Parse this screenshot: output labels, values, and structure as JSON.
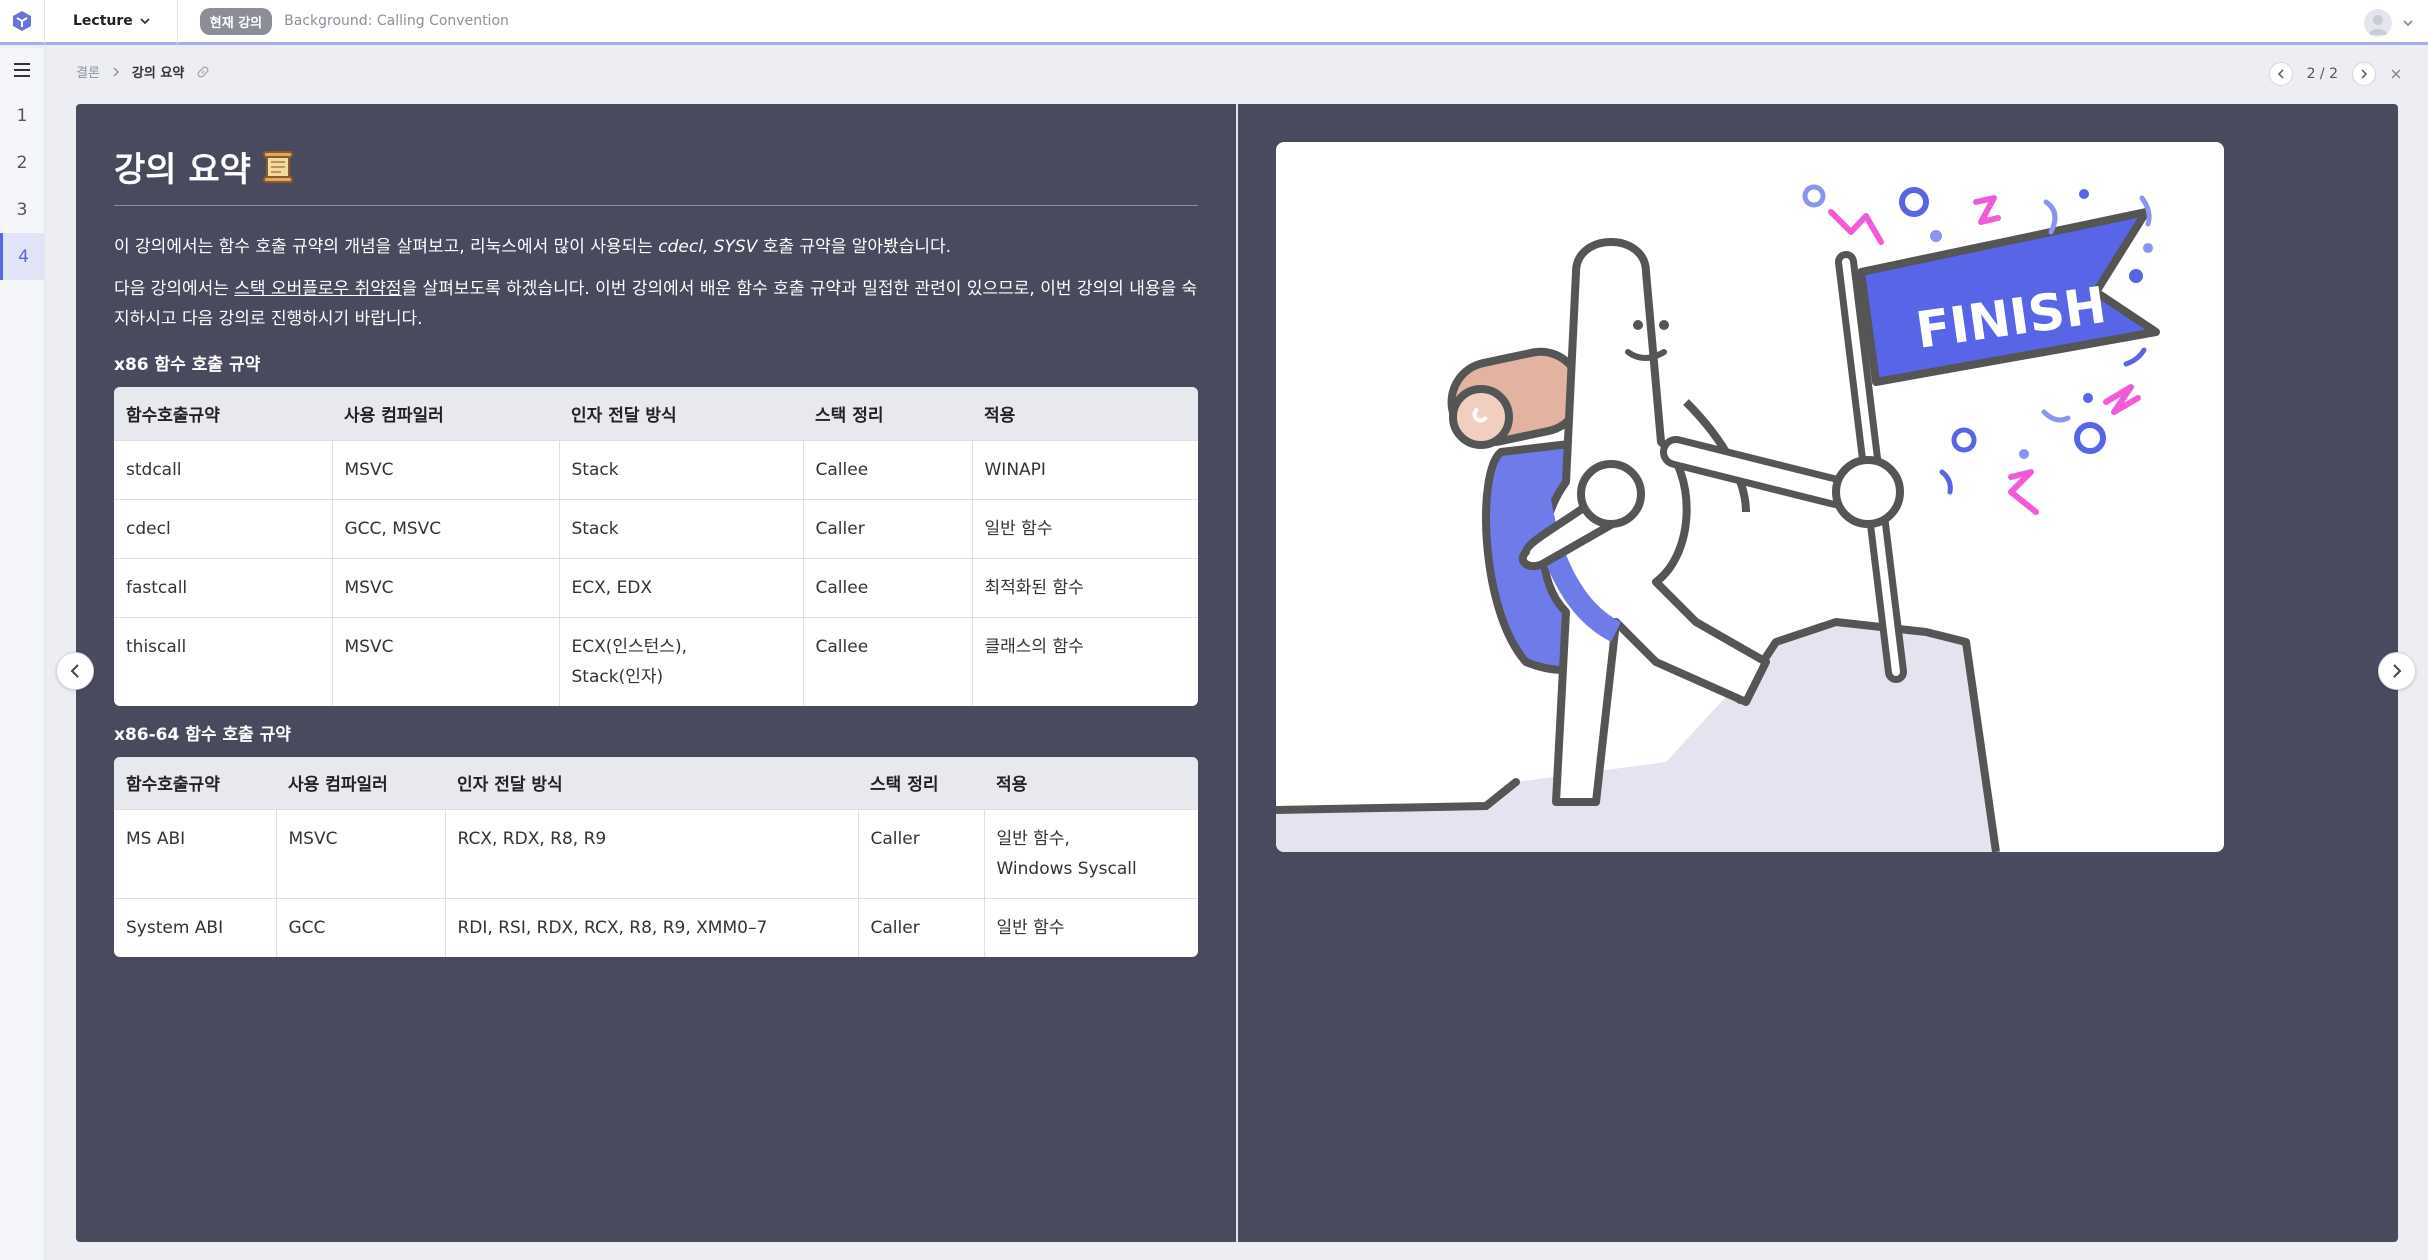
{
  "topbar": {
    "lecture_label": "Lecture",
    "current_badge": "현재 강의",
    "current_title": "Background: Calling Convention"
  },
  "rail": {
    "items": [
      {
        "label": "1"
      },
      {
        "label": "2"
      },
      {
        "label": "3"
      },
      {
        "label": "4",
        "active": true
      }
    ]
  },
  "breadcrumb": {
    "parent": "결론",
    "current": "강의 요약"
  },
  "pager": {
    "text": "2 / 2"
  },
  "slide": {
    "title": "강의 요약",
    "title_icon": "scroll-icon",
    "intro_prefix": "이 강의에서는 함수 호출 규약의 개념을 살펴보고, 리눅스에서 많이 사용되는 ",
    "intro_em": "cdecl, SYSV",
    "intro_suffix": " 호출 규약을 알아봤습니다.",
    "next_prefix": "다음 강의에서는 ",
    "next_link": "스택 오버플로우 취약점",
    "next_suffix": "을 살펴보도록 하겠습니다. 이번 강의에서 배운 함수 호출 규약과 밀접한 관련이 있으므로, 이번 강의의 내용을 숙지하시고 다음 강의로 진행하시기 바랍니다.",
    "x86_heading": "x86 함수 호출 규약",
    "x86_table": {
      "headers": [
        "함수호출규약",
        "사용 컴파일러",
        "인자 전달 방식",
        "스택 정리",
        "적용"
      ],
      "rows": [
        [
          "stdcall",
          "MSVC",
          "Stack",
          "Callee",
          "WINAPI"
        ],
        [
          "cdecl",
          "GCC, MSVC",
          "Stack",
          "Caller",
          "일반 함수"
        ],
        [
          "fastcall",
          "MSVC",
          "ECX, EDX",
          "Callee",
          "최적화된 함수"
        ],
        [
          "thiscall",
          "MSVC",
          "ECX(인스턴스),\nStack(인자)",
          "Callee",
          "클래스의 함수"
        ]
      ]
    },
    "x64_heading": "x86-64 함수 호출 규약",
    "x64_table": {
      "headers": [
        "함수호출규약",
        "사용 컴파일러",
        "인자 전달 방식",
        "스택 정리",
        "적용"
      ],
      "rows": [
        [
          "MS ABI",
          "MSVC",
          "RCX, RDX, R8, R9",
          "Caller",
          "일반 함수,\nWindows Syscall"
        ],
        [
          "System ABI",
          "GCC",
          "RDI, RSI, RDX, RCX, R8, R9, XMM0–7",
          "Caller",
          "일반 함수"
        ]
      ]
    },
    "flag_text": "FINISH"
  },
  "colors": {
    "accent": "#5865e6",
    "slide_bg": "#4a4a5e",
    "flag_blue": "#5865e6",
    "confetti_pink": "#f25bd8"
  }
}
